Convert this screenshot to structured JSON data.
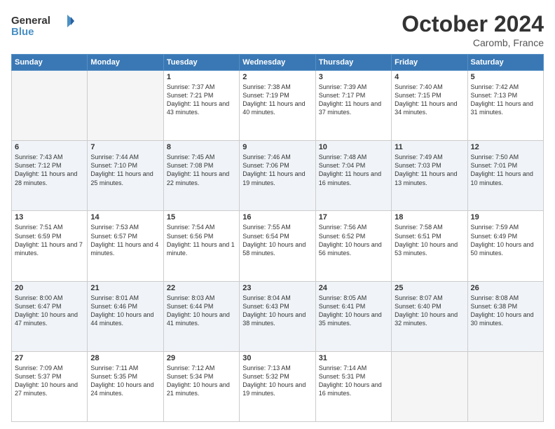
{
  "logo": {
    "line1": "General",
    "line2": "Blue"
  },
  "header": {
    "month": "October 2024",
    "location": "Caromb, France"
  },
  "weekdays": [
    "Sunday",
    "Monday",
    "Tuesday",
    "Wednesday",
    "Thursday",
    "Friday",
    "Saturday"
  ],
  "weeks": [
    [
      {
        "day": "",
        "info": ""
      },
      {
        "day": "",
        "info": ""
      },
      {
        "day": "1",
        "info": "Sunrise: 7:37 AM\nSunset: 7:21 PM\nDaylight: 11 hours and 43 minutes."
      },
      {
        "day": "2",
        "info": "Sunrise: 7:38 AM\nSunset: 7:19 PM\nDaylight: 11 hours and 40 minutes."
      },
      {
        "day": "3",
        "info": "Sunrise: 7:39 AM\nSunset: 7:17 PM\nDaylight: 11 hours and 37 minutes."
      },
      {
        "day": "4",
        "info": "Sunrise: 7:40 AM\nSunset: 7:15 PM\nDaylight: 11 hours and 34 minutes."
      },
      {
        "day": "5",
        "info": "Sunrise: 7:42 AM\nSunset: 7:13 PM\nDaylight: 11 hours and 31 minutes."
      }
    ],
    [
      {
        "day": "6",
        "info": "Sunrise: 7:43 AM\nSunset: 7:12 PM\nDaylight: 11 hours and 28 minutes."
      },
      {
        "day": "7",
        "info": "Sunrise: 7:44 AM\nSunset: 7:10 PM\nDaylight: 11 hours and 25 minutes."
      },
      {
        "day": "8",
        "info": "Sunrise: 7:45 AM\nSunset: 7:08 PM\nDaylight: 11 hours and 22 minutes."
      },
      {
        "day": "9",
        "info": "Sunrise: 7:46 AM\nSunset: 7:06 PM\nDaylight: 11 hours and 19 minutes."
      },
      {
        "day": "10",
        "info": "Sunrise: 7:48 AM\nSunset: 7:04 PM\nDaylight: 11 hours and 16 minutes."
      },
      {
        "day": "11",
        "info": "Sunrise: 7:49 AM\nSunset: 7:03 PM\nDaylight: 11 hours and 13 minutes."
      },
      {
        "day": "12",
        "info": "Sunrise: 7:50 AM\nSunset: 7:01 PM\nDaylight: 11 hours and 10 minutes."
      }
    ],
    [
      {
        "day": "13",
        "info": "Sunrise: 7:51 AM\nSunset: 6:59 PM\nDaylight: 11 hours and 7 minutes."
      },
      {
        "day": "14",
        "info": "Sunrise: 7:53 AM\nSunset: 6:57 PM\nDaylight: 11 hours and 4 minutes."
      },
      {
        "day": "15",
        "info": "Sunrise: 7:54 AM\nSunset: 6:56 PM\nDaylight: 11 hours and 1 minute."
      },
      {
        "day": "16",
        "info": "Sunrise: 7:55 AM\nSunset: 6:54 PM\nDaylight: 10 hours and 58 minutes."
      },
      {
        "day": "17",
        "info": "Sunrise: 7:56 AM\nSunset: 6:52 PM\nDaylight: 10 hours and 56 minutes."
      },
      {
        "day": "18",
        "info": "Sunrise: 7:58 AM\nSunset: 6:51 PM\nDaylight: 10 hours and 53 minutes."
      },
      {
        "day": "19",
        "info": "Sunrise: 7:59 AM\nSunset: 6:49 PM\nDaylight: 10 hours and 50 minutes."
      }
    ],
    [
      {
        "day": "20",
        "info": "Sunrise: 8:00 AM\nSunset: 6:47 PM\nDaylight: 10 hours and 47 minutes."
      },
      {
        "day": "21",
        "info": "Sunrise: 8:01 AM\nSunset: 6:46 PM\nDaylight: 10 hours and 44 minutes."
      },
      {
        "day": "22",
        "info": "Sunrise: 8:03 AM\nSunset: 6:44 PM\nDaylight: 10 hours and 41 minutes."
      },
      {
        "day": "23",
        "info": "Sunrise: 8:04 AM\nSunset: 6:43 PM\nDaylight: 10 hours and 38 minutes."
      },
      {
        "day": "24",
        "info": "Sunrise: 8:05 AM\nSunset: 6:41 PM\nDaylight: 10 hours and 35 minutes."
      },
      {
        "day": "25",
        "info": "Sunrise: 8:07 AM\nSunset: 6:40 PM\nDaylight: 10 hours and 32 minutes."
      },
      {
        "day": "26",
        "info": "Sunrise: 8:08 AM\nSunset: 6:38 PM\nDaylight: 10 hours and 30 minutes."
      }
    ],
    [
      {
        "day": "27",
        "info": "Sunrise: 7:09 AM\nSunset: 5:37 PM\nDaylight: 10 hours and 27 minutes."
      },
      {
        "day": "28",
        "info": "Sunrise: 7:11 AM\nSunset: 5:35 PM\nDaylight: 10 hours and 24 minutes."
      },
      {
        "day": "29",
        "info": "Sunrise: 7:12 AM\nSunset: 5:34 PM\nDaylight: 10 hours and 21 minutes."
      },
      {
        "day": "30",
        "info": "Sunrise: 7:13 AM\nSunset: 5:32 PM\nDaylight: 10 hours and 19 minutes."
      },
      {
        "day": "31",
        "info": "Sunrise: 7:14 AM\nSunset: 5:31 PM\nDaylight: 10 hours and 16 minutes."
      },
      {
        "day": "",
        "info": ""
      },
      {
        "day": "",
        "info": ""
      }
    ]
  ]
}
